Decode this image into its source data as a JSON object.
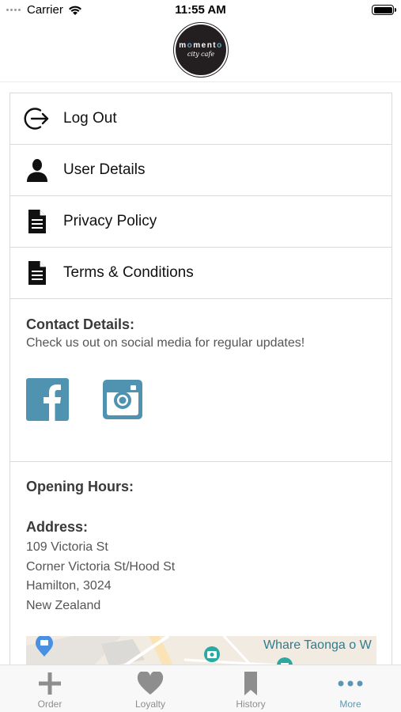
{
  "status_bar": {
    "carrier": "Carrier",
    "time": "11:55 AM",
    "icons": [
      "signal-dots-icon",
      "wifi-icon",
      "battery-icon"
    ],
    "battery_level": 1.0
  },
  "header": {
    "logo_word_parts": [
      "m",
      "o",
      "ment",
      "o"
    ],
    "logo_subtitle": "city cafe"
  },
  "menu": {
    "items": [
      {
        "label": "Log Out",
        "icon": "logout-icon"
      },
      {
        "label": "User Details",
        "icon": "user-icon"
      },
      {
        "label": "Privacy Policy",
        "icon": "document-icon"
      },
      {
        "label": "Terms & Conditions",
        "icon": "document-icon"
      }
    ]
  },
  "contact": {
    "title": "Contact Details:",
    "subtitle": "Check us out on social media for regular updates!",
    "social": [
      "facebook-icon",
      "instagram-icon"
    ]
  },
  "hours": {
    "title": "Opening Hours:",
    "address_title": "Address:",
    "address_lines": [
      "109 Victoria St",
      "Corner Victoria St/Hood St",
      "Hamilton, 3024",
      "New Zealand"
    ]
  },
  "map": {
    "label": "Whare Taonga o W"
  },
  "tabbar": {
    "tabs": [
      {
        "label": "Order",
        "icon": "plus-icon"
      },
      {
        "label": "Loyalty",
        "icon": "heart-icon"
      },
      {
        "label": "History",
        "icon": "bookmark-icon"
      },
      {
        "label": "More",
        "icon": "more-dots-icon"
      }
    ],
    "active": "More"
  },
  "colors": {
    "accent": "#5a98b5",
    "social": "#4f93b0",
    "divider": "#d9d9d9",
    "inactive_tab": "#8e8e8e"
  }
}
